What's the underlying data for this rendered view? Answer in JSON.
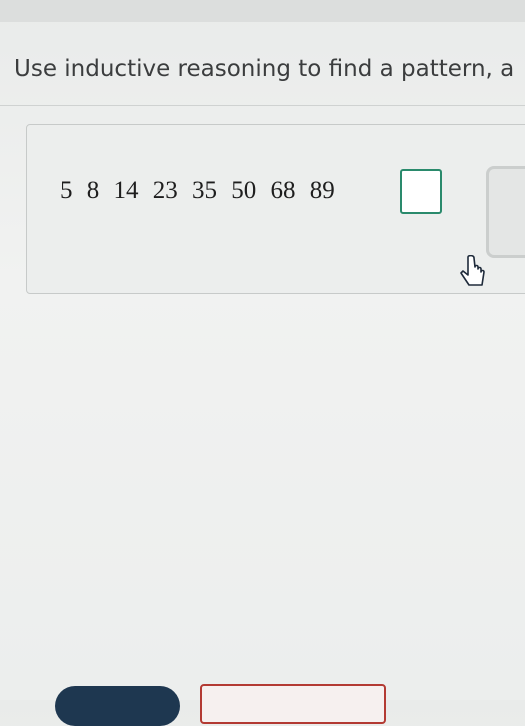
{
  "instruction": "Use inductive reasoning to find a pattern, a",
  "sequence": [
    "5",
    "8",
    "14",
    "23",
    "35",
    "50",
    "68",
    "89"
  ],
  "answer": {
    "value": ""
  },
  "colors": {
    "answer_border": "#2a8a6c",
    "bottom_dark_button": "#1e3750",
    "bottom_outline_button": "#b33a33"
  },
  "icons": {
    "cursor": "mouse-pointer-icon"
  }
}
